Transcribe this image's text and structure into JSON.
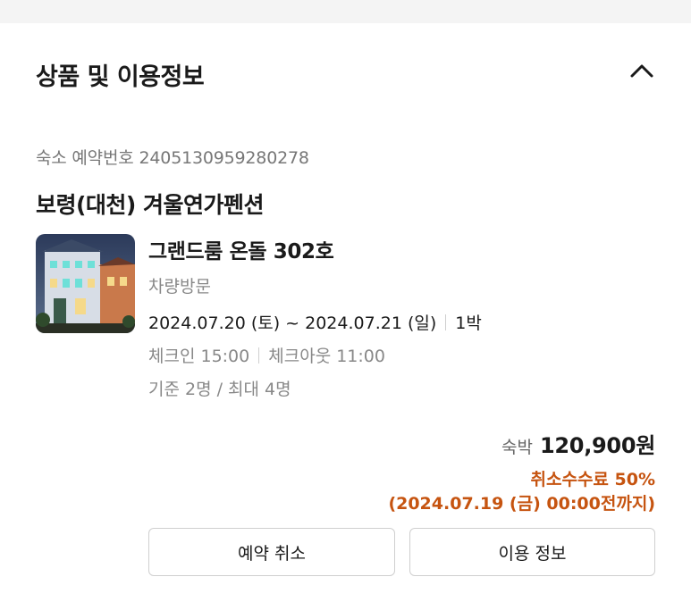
{
  "section": {
    "title": "상품 및 이용정보",
    "collapse_icon": "chevron-up-icon"
  },
  "reservation": {
    "label": "숙소 예약번호",
    "number": "2405130959280278"
  },
  "hotel": {
    "name": "보령(대천) 겨울연가펜션"
  },
  "room": {
    "name": "그랜드룸 온돌 302호",
    "visit_type": "차량방문",
    "date_range": "2024.07.20 (토) ~ 2024.07.21 (일)",
    "nights": "1박",
    "check_in": "체크인 15:00",
    "check_out": "체크아웃 11:00",
    "capacity": "기준 2명 / 최대 4명"
  },
  "price": {
    "label": "숙박",
    "amount": "120,900원"
  },
  "cancellation": {
    "fee": "취소수수료 50%",
    "deadline": "(2024.07.19 (금) 00:00전까지)"
  },
  "buttons": {
    "cancel": "예약 취소",
    "info": "이용 정보"
  },
  "colors": {
    "accent": "#c65410",
    "muted_text": "#888888",
    "border": "#cfcfcf"
  }
}
